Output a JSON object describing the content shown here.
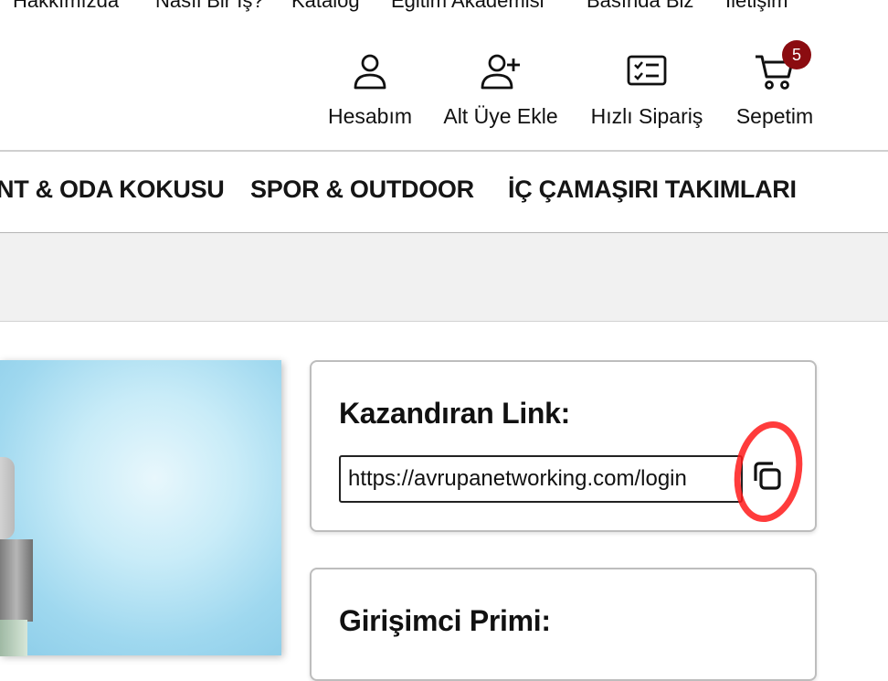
{
  "top_nav": [
    "Hakkımızda",
    "Nasıl Bir İş?",
    "Katalog",
    "Eğitim Akademisi",
    "Basında Biz",
    "İletişim"
  ],
  "header_actions": {
    "account": {
      "label": "Hesabım",
      "icon": "user-icon"
    },
    "add_sub_member": {
      "label": "Alt Üye Ekle",
      "icon": "user-plus-icon"
    },
    "quick_order": {
      "label": "Hızlı Sipariş",
      "icon": "checklist-icon"
    },
    "cart": {
      "label": "Sepetim",
      "icon": "cart-icon",
      "badge": "5"
    }
  },
  "categories": [
    "NT & ODA KOKUSU",
    "SPOR & OUTDOOR",
    "İÇ ÇAMAŞIRI TAKIMLARI"
  ],
  "referral_card": {
    "title": "Kazandıran Link:",
    "link_value": "https://avrupanetworking.com/login",
    "copy_icon": "copy-icon"
  },
  "bonus_card": {
    "title": "Girişimci Primi:"
  },
  "colors": {
    "badge": "#8b0c10",
    "annotation": "#ff1a1a",
    "grey_band": "#f1f1f1"
  }
}
